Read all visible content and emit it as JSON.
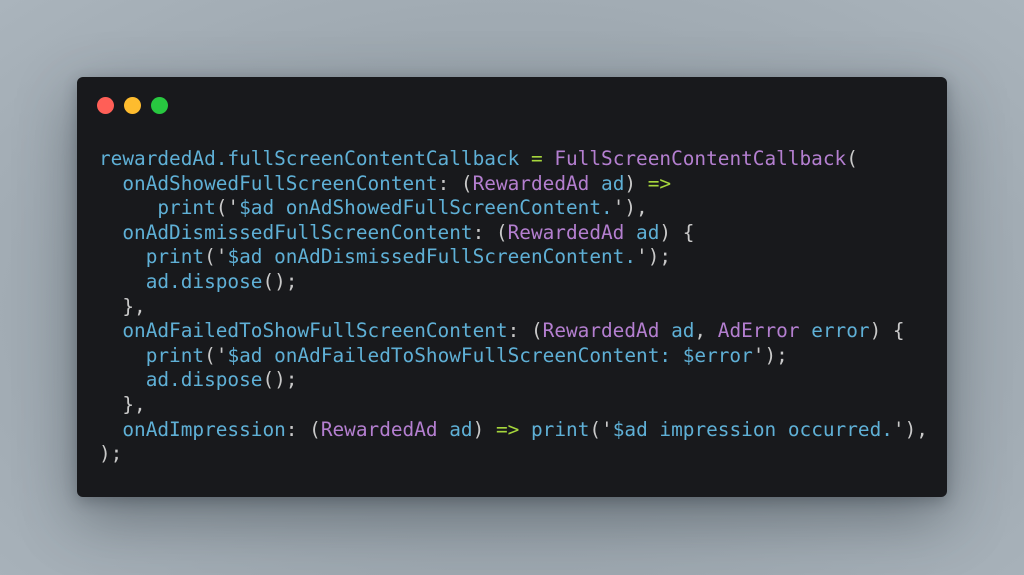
{
  "window": {
    "controls": [
      {
        "name": "close",
        "color": "#ff5f57"
      },
      {
        "name": "minimize",
        "color": "#febc2e"
      },
      {
        "name": "maximize",
        "color": "#28c840"
      }
    ]
  },
  "colors": {
    "identifier": "#5fb0d6",
    "type": "#b47fd0",
    "operator": "#a6d63c",
    "punctuation": "#c9c9c9",
    "background": "#18191c"
  },
  "code": {
    "language": "dart",
    "lines": [
      [
        [
          "id",
          "rewardedAd.fullScreenContentCallback "
        ],
        [
          "op",
          "="
        ],
        [
          "id",
          " "
        ],
        [
          "type",
          "FullScreenContentCallback"
        ],
        [
          "punc",
          "("
        ]
      ],
      [
        [
          "id",
          "  onAdShowedFullScreenContent"
        ],
        [
          "punc",
          ": ("
        ],
        [
          "type",
          "RewardedAd"
        ],
        [
          "id",
          " ad"
        ],
        [
          "punc",
          ") "
        ],
        [
          "op",
          "=>"
        ]
      ],
      [
        [
          "id",
          "     print"
        ],
        [
          "punc",
          "('"
        ],
        [
          "id",
          "$ad onAdShowedFullScreenContent."
        ],
        [
          "punc",
          "'),"
        ]
      ],
      [
        [
          "id",
          "  onAdDismissedFullScreenContent"
        ],
        [
          "punc",
          ": ("
        ],
        [
          "type",
          "RewardedAd"
        ],
        [
          "id",
          " ad"
        ],
        [
          "punc",
          ") {"
        ]
      ],
      [
        [
          "id",
          "    print"
        ],
        [
          "punc",
          "('"
        ],
        [
          "id",
          "$ad onAdDismissedFullScreenContent."
        ],
        [
          "punc",
          "');"
        ]
      ],
      [
        [
          "id",
          "    ad.dispose"
        ],
        [
          "punc",
          "();"
        ]
      ],
      [
        [
          "punc",
          "  },"
        ]
      ],
      [
        [
          "id",
          "  onAdFailedToShowFullScreenContent"
        ],
        [
          "punc",
          ": ("
        ],
        [
          "type",
          "RewardedAd"
        ],
        [
          "id",
          " ad"
        ],
        [
          "punc",
          ", "
        ],
        [
          "type",
          "AdError"
        ],
        [
          "id",
          " error"
        ],
        [
          "punc",
          ") {"
        ]
      ],
      [
        [
          "id",
          "    print"
        ],
        [
          "punc",
          "('"
        ],
        [
          "id",
          "$ad onAdFailedToShowFullScreenContent: $error"
        ],
        [
          "punc",
          "');"
        ]
      ],
      [
        [
          "id",
          "    ad.dispose"
        ],
        [
          "punc",
          "();"
        ]
      ],
      [
        [
          "punc",
          "  },"
        ]
      ],
      [
        [
          "id",
          "  onAdImpression"
        ],
        [
          "punc",
          ": ("
        ],
        [
          "type",
          "RewardedAd"
        ],
        [
          "id",
          " ad"
        ],
        [
          "punc",
          ") "
        ],
        [
          "op",
          "=>"
        ],
        [
          "id",
          " print"
        ],
        [
          "punc",
          "('"
        ],
        [
          "id",
          "$ad impression occurred."
        ],
        [
          "punc",
          "'),"
        ]
      ],
      [
        [
          "punc",
          ");"
        ]
      ]
    ]
  }
}
